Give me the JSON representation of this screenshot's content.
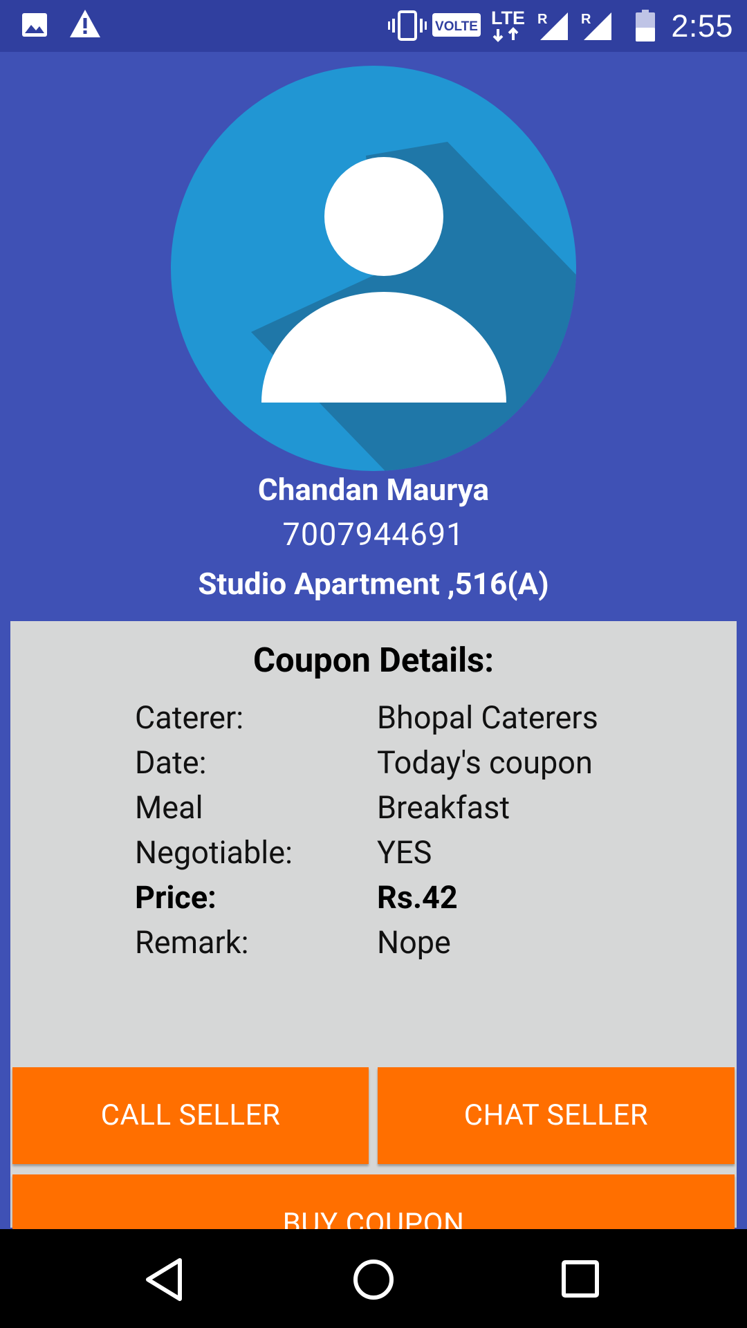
{
  "status_bar": {
    "time": "2:55",
    "volte_label": "VOLTE",
    "lte_label": "LTE",
    "roaming_label_1": "R",
    "roaming_label_2": "R",
    "icons": [
      "gallery-icon",
      "warning-icon",
      "vibrate-icon",
      "volte-icon",
      "lte-icon",
      "signal-icon",
      "signal-icon",
      "battery-icon"
    ]
  },
  "seller": {
    "name": "Chandan Maurya",
    "phone": "7007944691",
    "address": "Studio Apartment ,516(A)"
  },
  "coupon": {
    "title": "Coupon Details:",
    "rows": [
      {
        "label": "Caterer:",
        "value": "Bhopal Caterers"
      },
      {
        "label": "Date:",
        "value": "Today's coupon"
      },
      {
        "label": "Meal",
        "value": "Breakfast"
      },
      {
        "label": "Negotiable:",
        "value": "YES"
      },
      {
        "label": "Price:",
        "value": "Rs.42"
      },
      {
        "label": "Remark:",
        "value": "Nope"
      }
    ]
  },
  "actions": {
    "call_label": "CALL SELLER",
    "chat_label": "CHAT SELLER",
    "buy_label": "BUY COUPON"
  },
  "colors": {
    "status_bar": "#303f9f",
    "primary": "#3f51b5",
    "avatar_bg": "#2196d3",
    "panel_bg": "#d6d7d7",
    "accent_button": "#ff6f00"
  }
}
